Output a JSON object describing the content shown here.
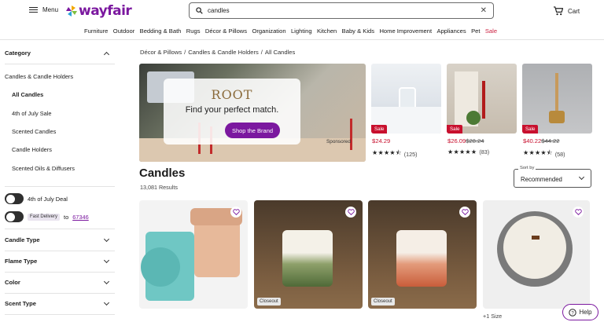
{
  "header": {
    "menu_label": "Menu",
    "logo_text": "wayfair",
    "search_value": "candles",
    "cart_label": "Cart",
    "brand_color": "#7b189f"
  },
  "nav": {
    "items": [
      "Furniture",
      "Outdoor",
      "Bedding & Bath",
      "Rugs",
      "Décor & Pillows",
      "Organization",
      "Lighting",
      "Kitchen",
      "Baby & Kids",
      "Home Improvement",
      "Appliances",
      "Pet"
    ],
    "sale": "Sale"
  },
  "sidebar": {
    "category_heading": "Category",
    "category_parent": "Candles & Candle Holders",
    "category_items": [
      "All Candles",
      "4th of July Sale",
      "Scented Candles",
      "Candle Holders",
      "Scented Oils & Diffusers"
    ],
    "toggle_deal": "4th of July Deal",
    "fast_delivery": "Fast Delivery",
    "to_label": "to",
    "zip": "67346",
    "filters": [
      "Candle Type",
      "Flame Type",
      "Color",
      "Scent Type"
    ]
  },
  "breadcrumb": [
    "Décor & Pillows",
    "Candles & Candle Holders",
    "All Candles"
  ],
  "banner": {
    "logo": "ROOT",
    "tagline": "Find your perfect match.",
    "button": "Shop the Brand",
    "sponsored": "Sponsored"
  },
  "sponsored_products": [
    {
      "badge": "Sale",
      "price": "$24.29",
      "original": "",
      "stars": "★★★★⯪",
      "count": "(125)"
    },
    {
      "badge": "Sale",
      "price": "$26.09",
      "original": "$28.24",
      "stars": "★★★★★",
      "count": "(83)"
    },
    {
      "badge": "Sale",
      "price": "$40.22",
      "original": "$44.22",
      "stars": "★★★★⯪",
      "count": "(58)"
    }
  ],
  "results": {
    "title": "Candles",
    "count": "13,081 Results",
    "sort_label": "Sort by",
    "sort_value": "Recommended"
  },
  "products": [
    {
      "badge": ""
    },
    {
      "badge": "Closeout"
    },
    {
      "badge": "Closeout"
    },
    {
      "badge": ""
    }
  ],
  "size_note": "+1 Size",
  "help_label": "Help"
}
